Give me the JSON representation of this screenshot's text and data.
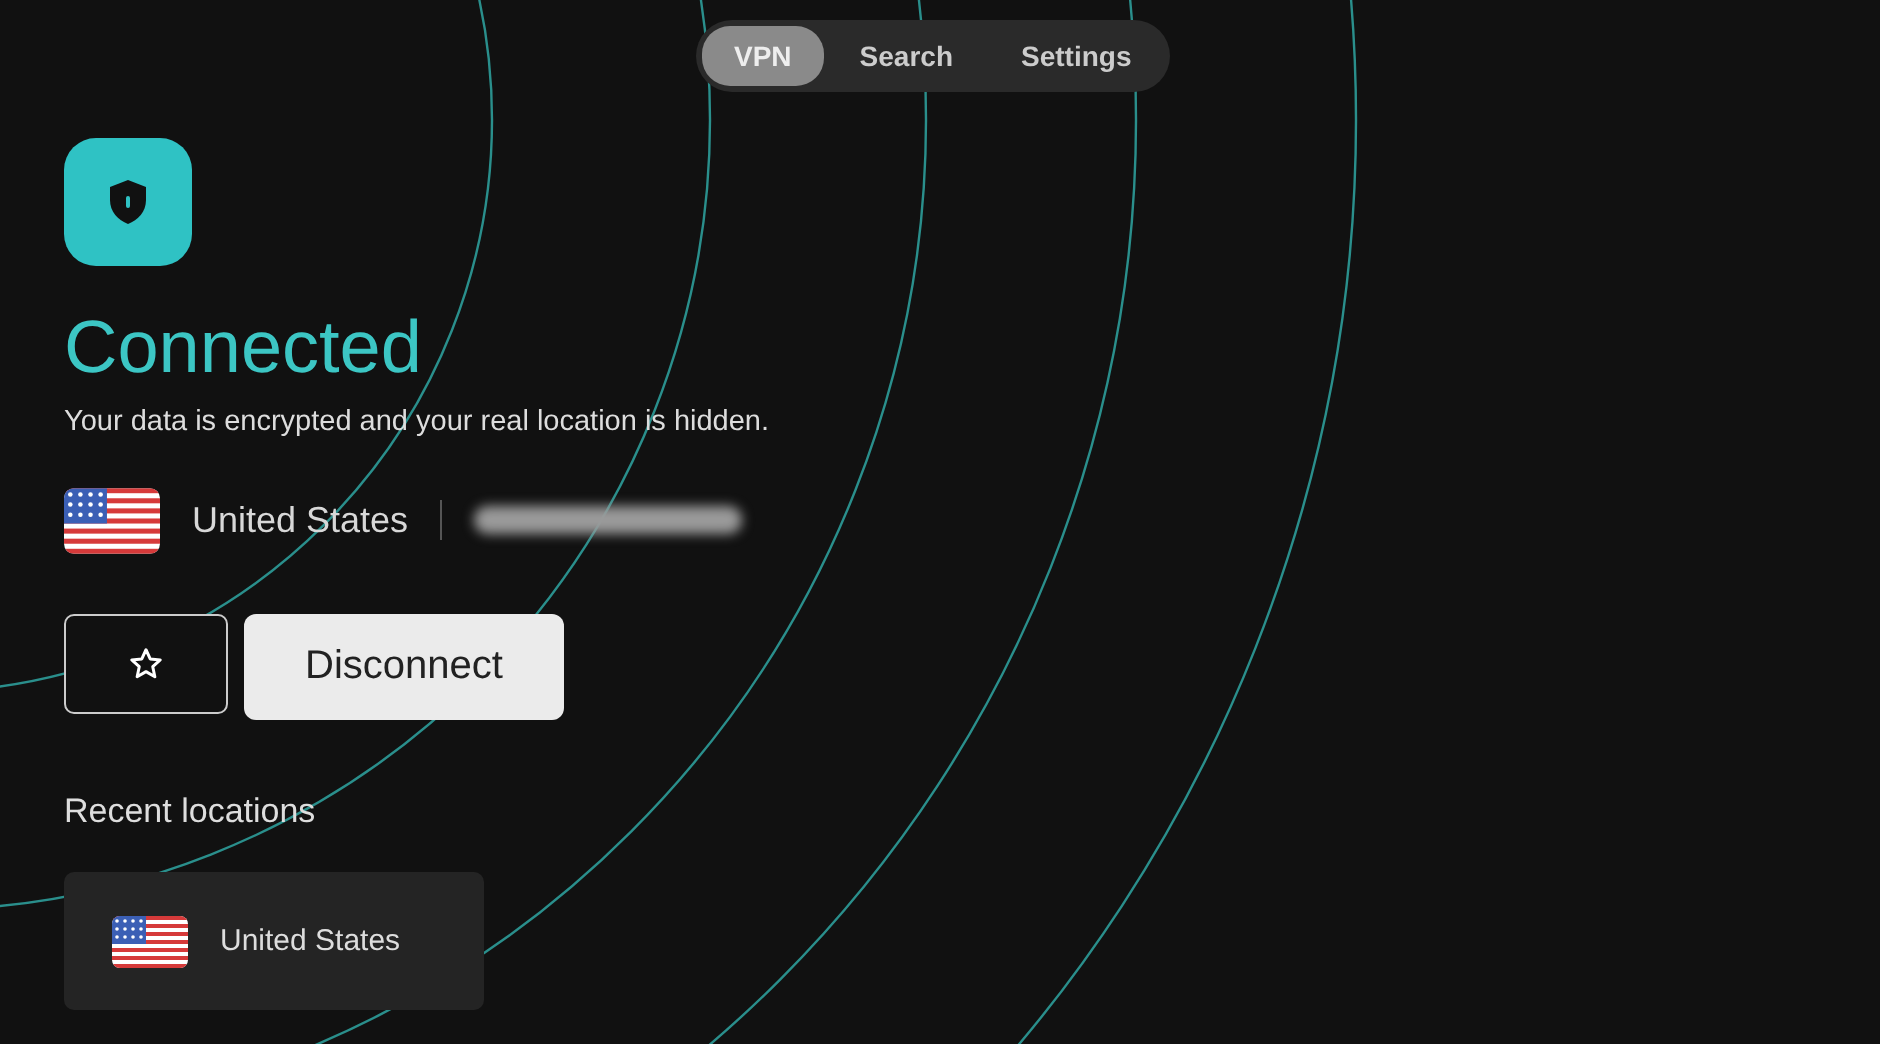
{
  "tabs": [
    {
      "label": "VPN",
      "selected": true
    },
    {
      "label": "Search",
      "selected": false
    },
    {
      "label": "Settings",
      "selected": false
    }
  ],
  "status": {
    "title": "Connected",
    "description": "Your data is encrypted and your real location is hidden.",
    "location": "United States"
  },
  "actions": {
    "disconnect": "Disconnect"
  },
  "recent": {
    "heading": "Recent locations",
    "items": [
      {
        "name": "United States"
      }
    ]
  }
}
